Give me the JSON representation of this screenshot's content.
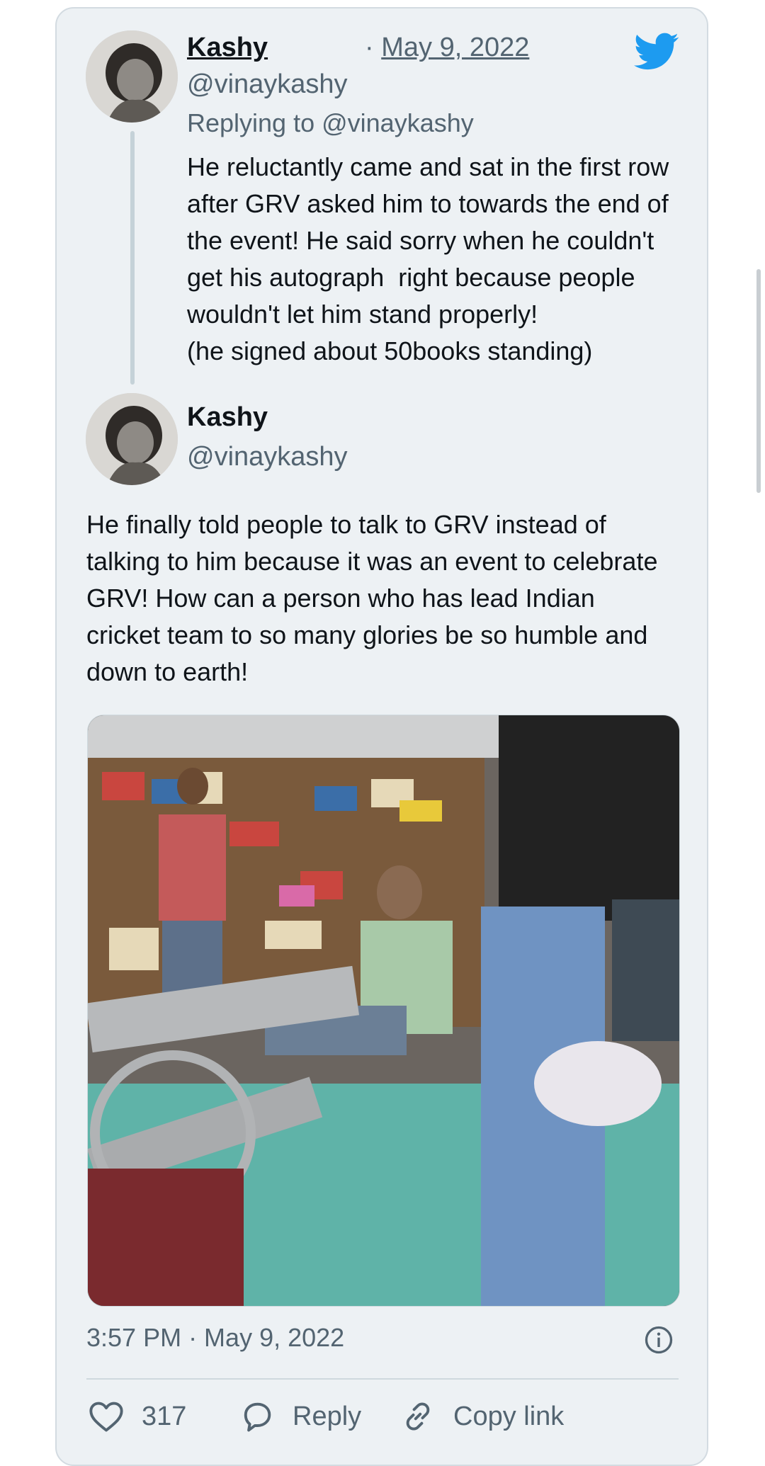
{
  "reply_tweet": {
    "author_name": "Kashy",
    "separator": "·",
    "date": "May 9, 2022",
    "handle": "@vinaykashy",
    "replying_to": "Replying to @vinaykashy",
    "text": "He reluctantly came and sat in the first row after GRV asked him to towards the end of the event! He said sorry when he couldn't get his autograph  right because people wouldn't let him stand properly!\n(he signed about 50books standing)"
  },
  "main_tweet": {
    "author_name": "Kashy",
    "handle": "@vinaykashy",
    "text": "He finally told people to talk to GRV instead of talking to him because it was an event to celebrate GRV! How can a person who has lead Indian cricket team to so many glories be so humble and down to earth!",
    "timestamp": "3:57 PM · May 9, 2022",
    "photo_icon": "photo-bookstore-event"
  },
  "actions": {
    "like_count": "317",
    "reply_label": "Reply",
    "copy_label": "Copy link"
  },
  "icons": {
    "brand": "twitter-bird-icon",
    "info": "info-icon",
    "like": "heart-icon",
    "reply": "speech-bubble-icon",
    "copy": "link-icon"
  },
  "colors": {
    "twitter_blue": "#1d9bf0",
    "card_bg": "#edf1f4",
    "secondary_text": "#536471"
  }
}
